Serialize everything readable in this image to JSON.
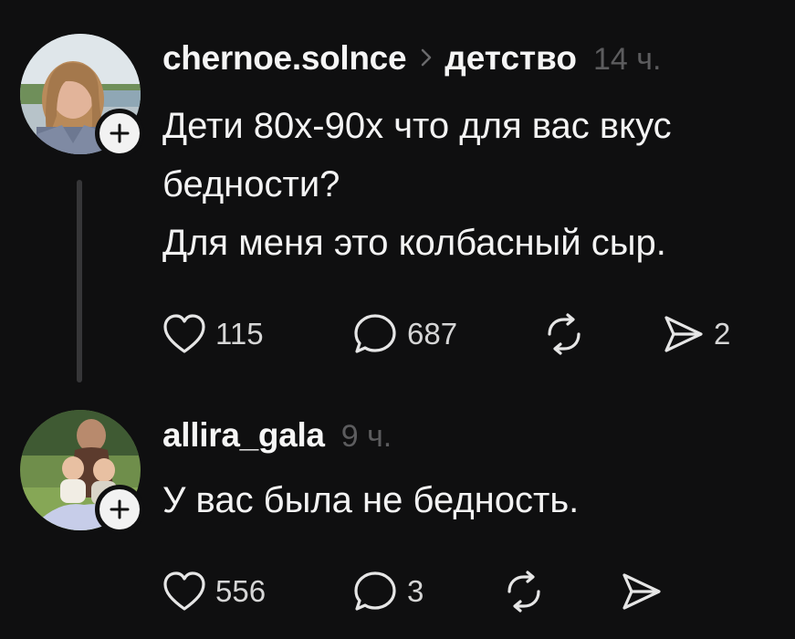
{
  "posts": [
    {
      "username": "chernoe.solnce",
      "topic": "детство",
      "time": "14 ч.",
      "text_lines": [
        "Дети 80х-90х что для вас вкус",
        "бедности?",
        "Для меня это колбасный сыр."
      ],
      "likes": "115",
      "comments": "687",
      "reposts": "",
      "shares": "2"
    },
    {
      "username": "allira_gala",
      "time": "9 ч.",
      "text_lines": [
        "У вас была не бедность."
      ],
      "likes": "556",
      "comments": "3",
      "reposts": "",
      "shares": ""
    }
  ],
  "icons": {
    "like": "heart-icon",
    "comment": "comment-bubble-icon",
    "repost": "repost-icon",
    "share": "send-icon",
    "follow": "plus-icon",
    "topic_separator": "chevron-right-icon"
  },
  "colors": {
    "background": "#0f0f10",
    "text": "#f3f3f3",
    "muted": "#5c5c5e"
  }
}
